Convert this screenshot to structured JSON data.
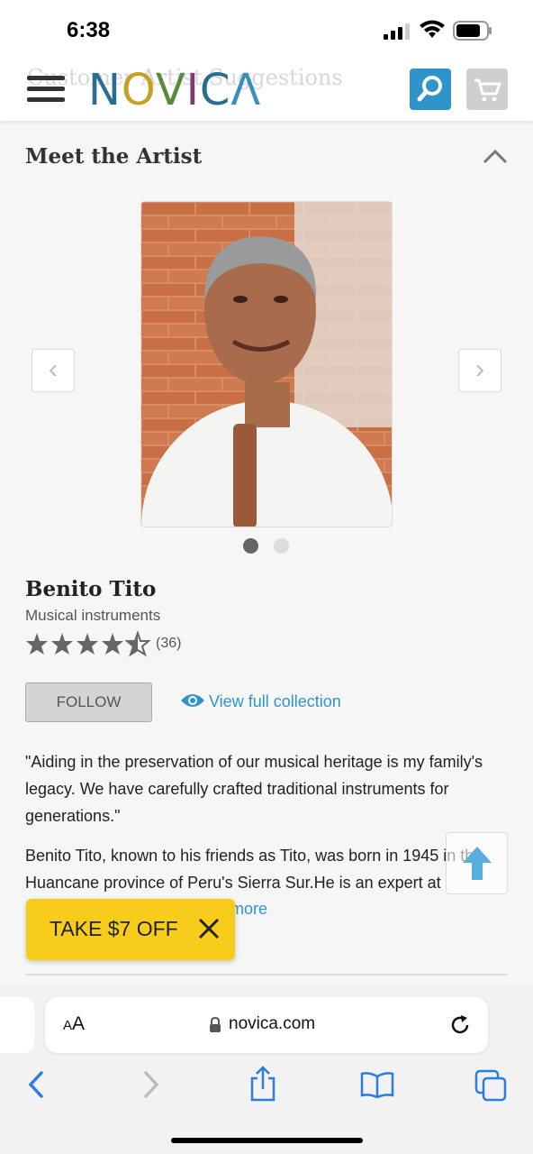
{
  "status_bar": {
    "time": "6:38"
  },
  "header": {
    "ghost_text": "Customer Artist Suggestions",
    "logo": "NOVICA"
  },
  "section": {
    "title": "Meet the Artist"
  },
  "carousel": {
    "prev": "‹",
    "next": "›",
    "active_index": 1,
    "count": 2
  },
  "artist": {
    "name": "Benito Tito",
    "category": "Musical instruments",
    "rating": 4.5,
    "review_count": "(36)",
    "follow_label": "FOLLOW",
    "collection_label": "View full collection",
    "quote": "\"Aiding in the preservation of our musical heritage is my family's legacy. We have carefully crafted traditional instruments for generations.\"",
    "bio": "Benito Tito, known to his friends as Tito, was born in 1945 in the Huancane province of Peru's Sierra Sur.He is an expert at",
    "read_more": "more"
  },
  "promo": {
    "label": "TAKE $7 OFF"
  },
  "browser": {
    "aa_label": "AA",
    "url": "novica.com"
  },
  "colors": {
    "accent": "#2e94c9",
    "promo": "#f7cc1a",
    "follow_bg": "#d4d4d4"
  }
}
